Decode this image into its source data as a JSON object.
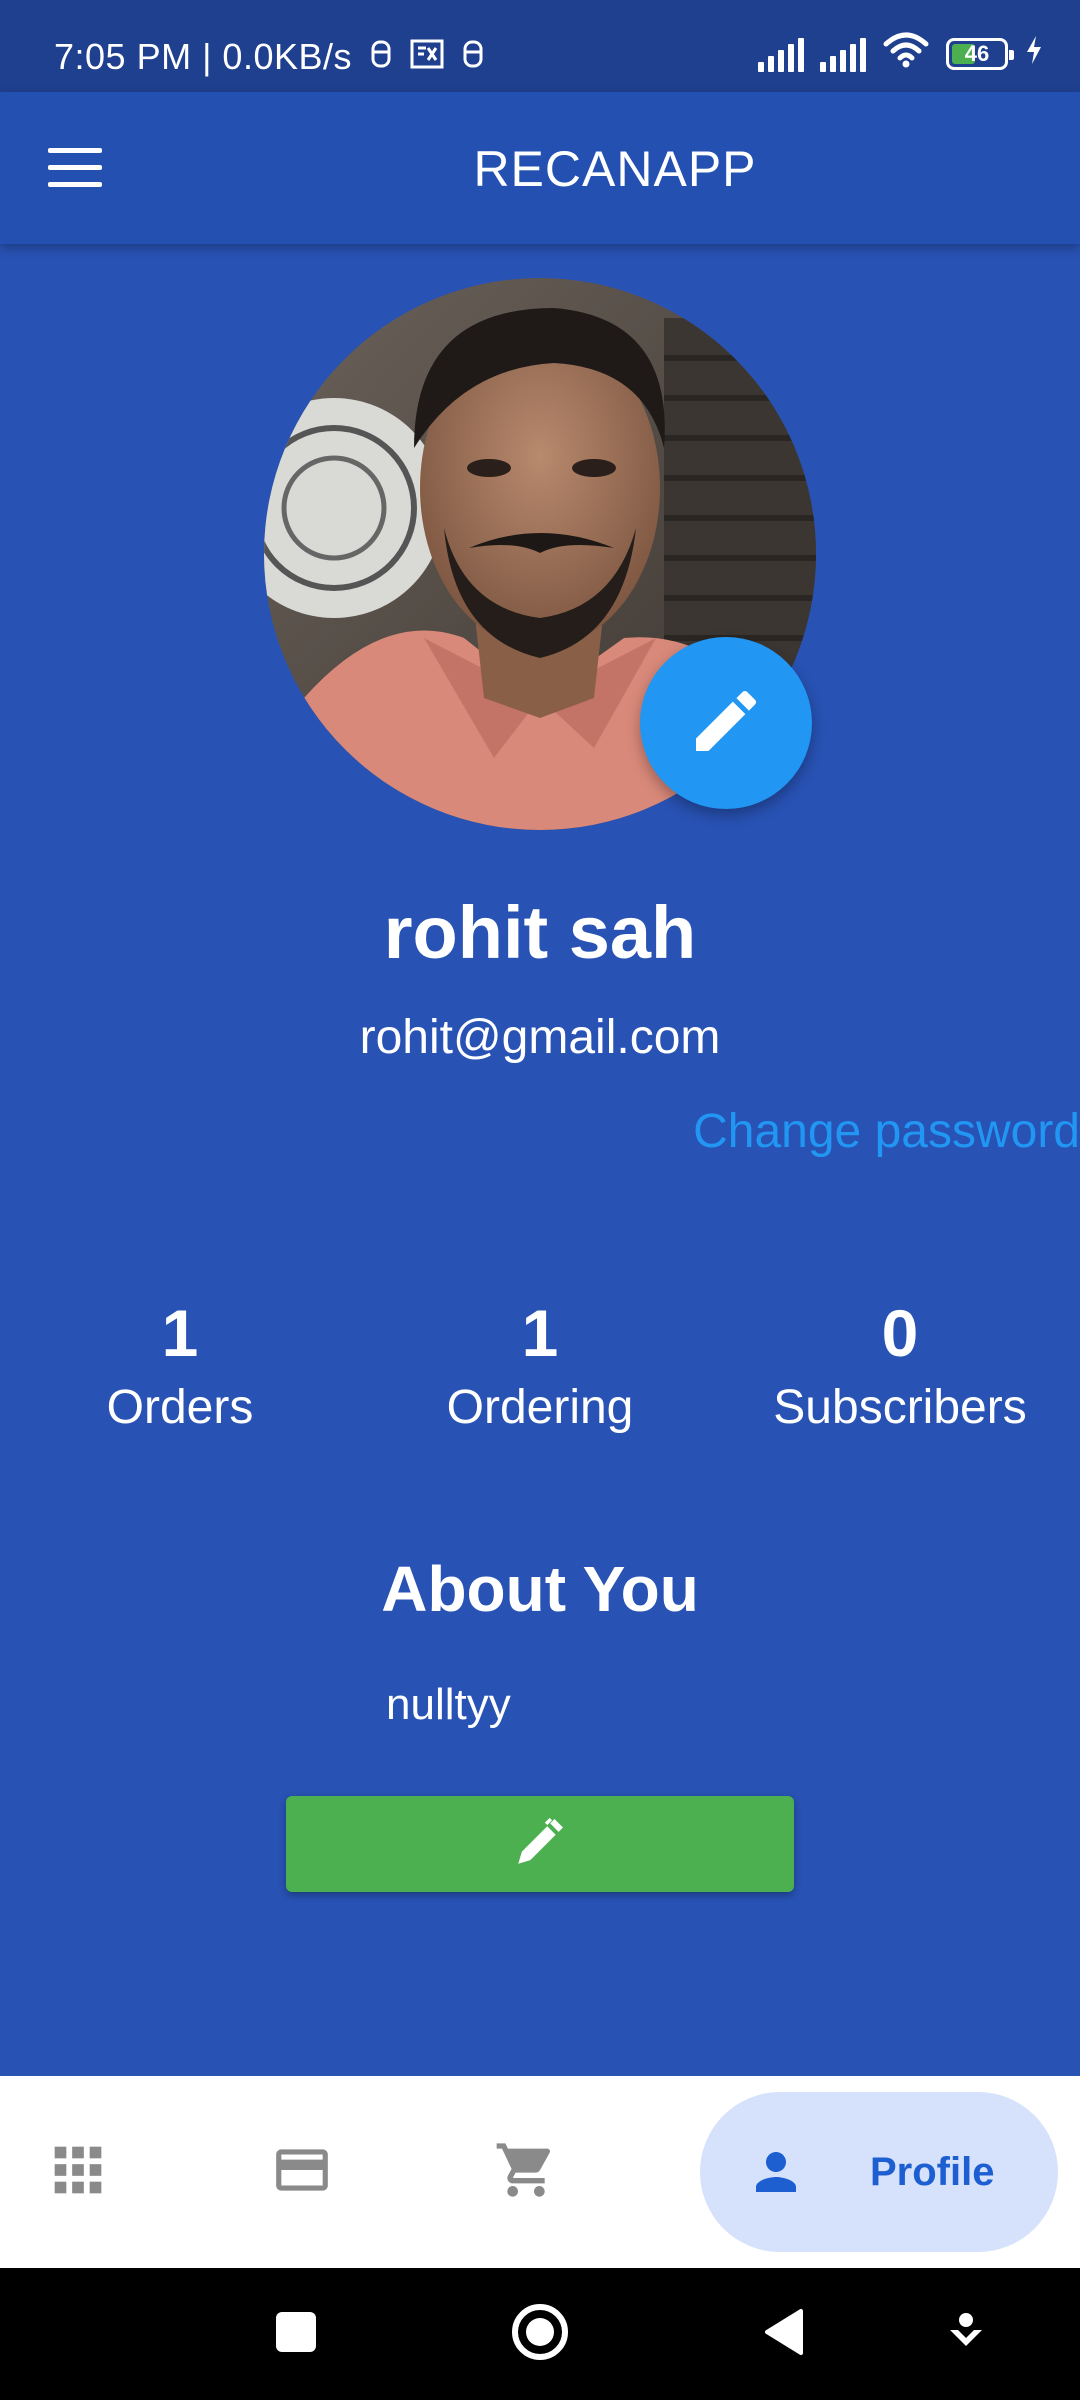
{
  "status_bar": {
    "time": "7:05 PM | 0.0KB/s",
    "battery_level": "46",
    "battery_fraction": 0.46,
    "icons": [
      "notification-icon",
      "notification-icon",
      "notification-icon",
      "signal-icon",
      "signal-icon",
      "wifi-icon",
      "battery-icon",
      "charging-icon"
    ]
  },
  "app_bar": {
    "title": "RECANAPP",
    "menu_icon": "menu-icon"
  },
  "profile": {
    "name": "rohit sah",
    "email": "rohit@gmail.com",
    "change_password_label": "Change password",
    "edit_avatar_icon": "pencil-icon"
  },
  "stats": [
    {
      "count": "1",
      "label": "Orders"
    },
    {
      "count": "1",
      "label": "Ordering"
    },
    {
      "count": "0",
      "label": "Subscribers"
    }
  ],
  "about": {
    "heading": "About You",
    "text": "nulltyy",
    "edit_icon": "pen-icon"
  },
  "bottom_nav": {
    "items": [
      {
        "icon": "apps-grid-icon"
      },
      {
        "icon": "credit-card-icon"
      },
      {
        "icon": "cart-icon"
      }
    ],
    "active": {
      "icon": "person-icon",
      "label": "Profile"
    }
  },
  "colors": {
    "background": "#2852b4",
    "app_bar": "#2450b2",
    "status_bar": "#1f3f8f",
    "accent": "#2196f3",
    "edit_button": "#4caf50",
    "nav_active_pill": "#d6e2fb",
    "nav_active_text": "#1d5fd0"
  }
}
